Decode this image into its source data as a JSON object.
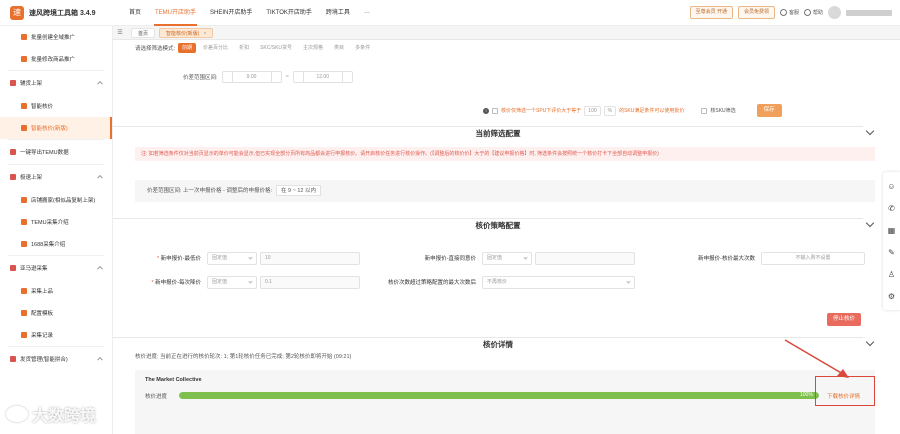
{
  "app": {
    "title": "速风跨境工具箱 3.4.9"
  },
  "nav": {
    "items": [
      "首页",
      "TEMU开店助手",
      "SHEIN开店助手",
      "TIKTOK开店助手",
      "跨境工具",
      "···"
    ],
    "active_index": 1
  },
  "topbar": {
    "pill1": "至尊会员 开通",
    "pill2": "会员免费领",
    "support": "客服",
    "help": "帮助"
  },
  "sidebar": {
    "items": [
      {
        "label": "批量创建全域推广",
        "type": "sub"
      },
      {
        "label": "批量修改商品推广",
        "type": "sub"
      },
      {
        "label": "辅货上架",
        "type": "group"
      },
      {
        "label": "智能核价",
        "type": "sub"
      },
      {
        "label": "智能核价(新版)",
        "type": "sub",
        "active": true
      },
      {
        "label": "一键导出TEMU数据",
        "type": "group"
      },
      {
        "label": "极速上架",
        "type": "group"
      },
      {
        "label": "店铺搬家(相似品复制上架)",
        "type": "sub"
      },
      {
        "label": "TEMU采集介绍",
        "type": "sub"
      },
      {
        "label": "1688采集介绍",
        "type": "sub"
      },
      {
        "label": "亚马逊采集",
        "type": "group"
      },
      {
        "label": "采集上品",
        "type": "sub"
      },
      {
        "label": "配置模板",
        "type": "sub"
      },
      {
        "label": "采集记录",
        "type": "sub"
      },
      {
        "label": "发货管理(智能拼合)",
        "type": "group"
      }
    ]
  },
  "tabs": {
    "home": "首页",
    "current": "智能核价(新版)",
    "close": "×"
  },
  "filter": {
    "label": "请选择筛选模式:",
    "options": [
      "前期",
      "价差百分比",
      "折扣",
      "SKC/SKU货号",
      "主次规格",
      "类目",
      "多条件"
    ],
    "active_index": 0,
    "range_label": "价差范围区间:",
    "range_from": "9.00",
    "range_sep": "~",
    "range_to": "12.00",
    "opt_text": "核价仅筛选一个SPU下评价大于等于",
    "opt_value": "100",
    "opt_unit": "%",
    "opt_text2": "的SKU满足条件可以使用批价",
    "chk_label": "核SKU筛选",
    "save_btn": "保存"
  },
  "section1": {
    "title": "当前筛选配置",
    "warning": "注: 如若筛选条件仅对当前页显示的单价可能会显示,但已实现全部分页所有商品都会进行申报核价。请开启核价任务进行核价操作。(【调整后的核价价】大于的【建议申报价格】时, 筛选条件会按照统一个核价打卡下全部自动调整申报价)",
    "info_label": "价差范围区间: 上一次申报价格 - 调整后的申报价格:",
    "info_tag": "在 9 ~ 12 以内"
  },
  "section2": {
    "title": "核价策略配置",
    "row1": [
      {
        "label": "新申报价-最低价",
        "required": true,
        "select": "固定值",
        "input": "10"
      },
      {
        "label": "新申报价-直接同意价",
        "required": false,
        "select": "固定值",
        "input": ""
      },
      {
        "label": "新申报价-核价最大次数",
        "required": false,
        "select": "",
        "input": "不输入则不设置"
      }
    ],
    "row2": [
      {
        "label": "新申报价-每次降价",
        "required": true,
        "select": "固定值",
        "input": "0.1"
      },
      {
        "label": "核价次数超过策略配置的最大次数后",
        "required": false,
        "select": "不再核价",
        "input": ""
      }
    ],
    "stop_btn": "停止核价"
  },
  "section3": {
    "title": "核价详情",
    "progress_text": "核价进度: 当前正在进行的核价轮次: 1; 第1轮核价任务已完成; 第2轮核价即将开始 (09:21)",
    "task_name": "The Market Collective",
    "task_label": "核价进度",
    "task_progress": 1.0,
    "task_pct_label": "100%",
    "download": "下载核价详情"
  },
  "watermark": {
    "text": "大数跨境"
  },
  "colors": {
    "accent": "#e8702c",
    "progress": "#7fbf4d",
    "highlight": "#d9473d"
  },
  "right_tools": [
    "chat-icon",
    "wechat-icon",
    "qrcode-icon",
    "note-icon",
    "user-icon",
    "user-settings-icon"
  ]
}
